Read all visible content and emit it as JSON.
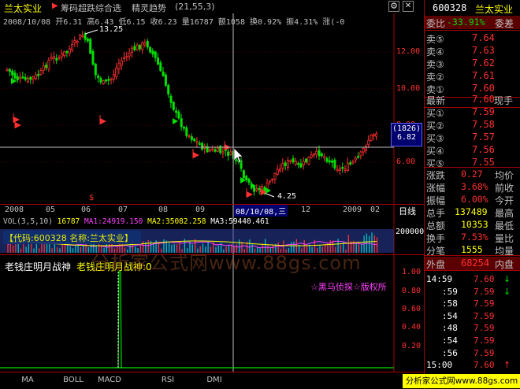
{
  "header": {
    "stock_name": "兰太实业",
    "indicator1": "筹码超跌综合选",
    "indicator2": "精灵趋势",
    "indicator2_params": "(21,55,3)"
  },
  "info_bar": {
    "date": "2008/10/08",
    "open_label": "开",
    "open": "6.31",
    "high_label": "高",
    "high": "6.43",
    "low_label": "低",
    "low": "6.15",
    "close_label": "收",
    "close": "6.23",
    "vol_label": "量",
    "vol": "16787",
    "amount_label": "额",
    "amount": "1058",
    "turnover_label": "换",
    "turnover": "0.92%",
    "amplitude_label": "振",
    "amplitude": "4.31%",
    "change_label": "涨",
    "change": "(-0"
  },
  "price_chart": {
    "y_labels": [
      "12.00",
      "10.00",
      "8.00",
      "6.00"
    ],
    "high_annotation": "13.25",
    "low_annotation": "4.25",
    "crosshair_box": [
      "(1826)",
      "6.82"
    ],
    "date_axis": [
      "2008",
      "05",
      "06",
      "07",
      "08",
      "09",
      "08/10/08,三",
      "12",
      "2009",
      "02"
    ],
    "period_label": "日线"
  },
  "volume_panel": {
    "title": "VOL(3,5,10)",
    "vol_value": "16787",
    "ma1_label": "MA1:",
    "ma1": "24919.150",
    "ma2_label": "MA2:",
    "ma2": "35082.258",
    "ma3_label": "MA3:",
    "ma3": "59440.461",
    "y_label": "200000",
    "info_prefix": "【代码:600328 名称:兰太实业】"
  },
  "indicator_panel": {
    "title": "老钱庄明月战神",
    "subtitle": "老钱庄明月战神:0",
    "y_labels": [
      "1.00",
      "0.80",
      "0.60",
      "0.40",
      "0.20"
    ],
    "banner": "☆黑马侦探☆版权所"
  },
  "watermark": "分析家公式网www.88gs.com",
  "buttons": [
    "MA",
    "BOLL",
    "MACD",
    "RSI",
    "DMI"
  ],
  "right_panel": {
    "code": "600328",
    "name": "兰太实业",
    "weibi_label": "委比",
    "weibi": "-33.91%",
    "weicha_label": "委差",
    "weicha": "",
    "sell": [
      {
        "label": "卖⑤",
        "price": "7.64",
        "vol": ""
      },
      {
        "label": "卖④",
        "price": "7.63",
        "vol": ""
      },
      {
        "label": "卖③",
        "price": "7.62",
        "vol": ""
      },
      {
        "label": "卖②",
        "price": "7.61",
        "vol": ""
      },
      {
        "label": "卖①",
        "price": "7.60",
        "vol": ""
      }
    ],
    "latest_label": "最新",
    "latest": "7.60",
    "current_label": "现手",
    "buy": [
      {
        "label": "买①",
        "price": "7.59",
        "vol": ""
      },
      {
        "label": "买②",
        "price": "7.58",
        "vol": ""
      },
      {
        "label": "买③",
        "price": "7.57",
        "vol": ""
      },
      {
        "label": "买④",
        "price": "7.56",
        "vol": ""
      },
      {
        "label": "买⑤",
        "price": "7.55",
        "vol": ""
      }
    ],
    "stats": [
      {
        "l1": "涨跌",
        "v1": "0.27",
        "l2": "均价"
      },
      {
        "l1": "涨幅",
        "v1": "3.68%",
        "l2": "前收"
      },
      {
        "l1": "振幅",
        "v1": "6.00%",
        "l2": "今开"
      },
      {
        "l1": "总手",
        "v1": "137489",
        "l2": "最高"
      },
      {
        "l1": "总额",
        "v1": "10353",
        "l2": "最低"
      },
      {
        "l1": "换手",
        "v1": "7.53%",
        "l2": "量比"
      },
      {
        "l1": "分笔",
        "v1": "1555",
        "l2": "均量"
      }
    ],
    "outer_label": "外盘",
    "outer": "68254",
    "inner_label": "内盘",
    "ticks": [
      {
        "time": "14:59",
        "price": "7.60",
        "dir": "↓"
      },
      {
        "time": ":59",
        "price": "7.59",
        "dir": "↓"
      },
      {
        "time": ":58",
        "price": "7.59",
        "dir": ""
      },
      {
        "time": ":54",
        "price": "7.59",
        "dir": ""
      },
      {
        "time": ":48",
        "price": "7.59",
        "dir": ""
      },
      {
        "time": ":54",
        "price": "7.59",
        "dir": ""
      },
      {
        "time": ":56",
        "price": "7.59",
        "dir": ""
      },
      {
        "time": "15:00",
        "price": "7.60",
        "dir": "↑"
      }
    ]
  }
}
